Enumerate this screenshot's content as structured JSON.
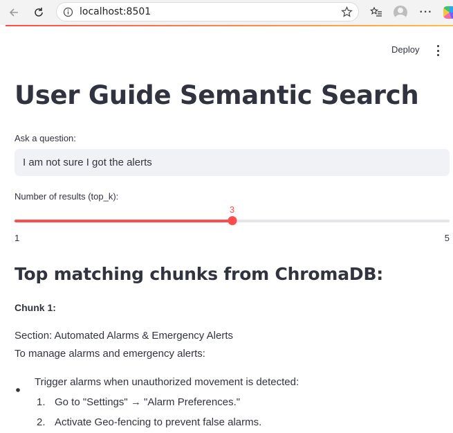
{
  "browser": {
    "url": "localhost:8501",
    "icons": [
      "back-icon",
      "refresh-icon",
      "info-icon",
      "star-icon",
      "favorites-icon",
      "profile-avatar",
      "more-icon",
      "copilot-icon"
    ]
  },
  "toolbar": {
    "deploy_label": "Deploy"
  },
  "main": {
    "title": "User Guide Semantic Search",
    "question_label": "Ask a question:",
    "question_value": "I am not sure I got the alerts",
    "slider": {
      "label": "Number of results (top_k):",
      "value": 3,
      "min": 1,
      "max": 5,
      "value_label": "3",
      "min_label": "1",
      "max_label": "5",
      "accent": "#ff4b4b"
    },
    "results_heading": "Top matching chunks from ChromaDB:",
    "chunk": {
      "heading": "Chunk 1:",
      "section_line": "Section: Automated Alarms & Emergency Alerts",
      "intro_line": "To manage alarms and emergency alerts:",
      "bullet": "Trigger alarms when unauthorized movement is detected:",
      "steps": [
        {
          "num": "1.",
          "text": "Go to \"Settings\" → \"Alarm Preferences.\""
        },
        {
          "num": "2.",
          "text": "Activate Geo-fencing to prevent false alarms."
        }
      ]
    }
  }
}
